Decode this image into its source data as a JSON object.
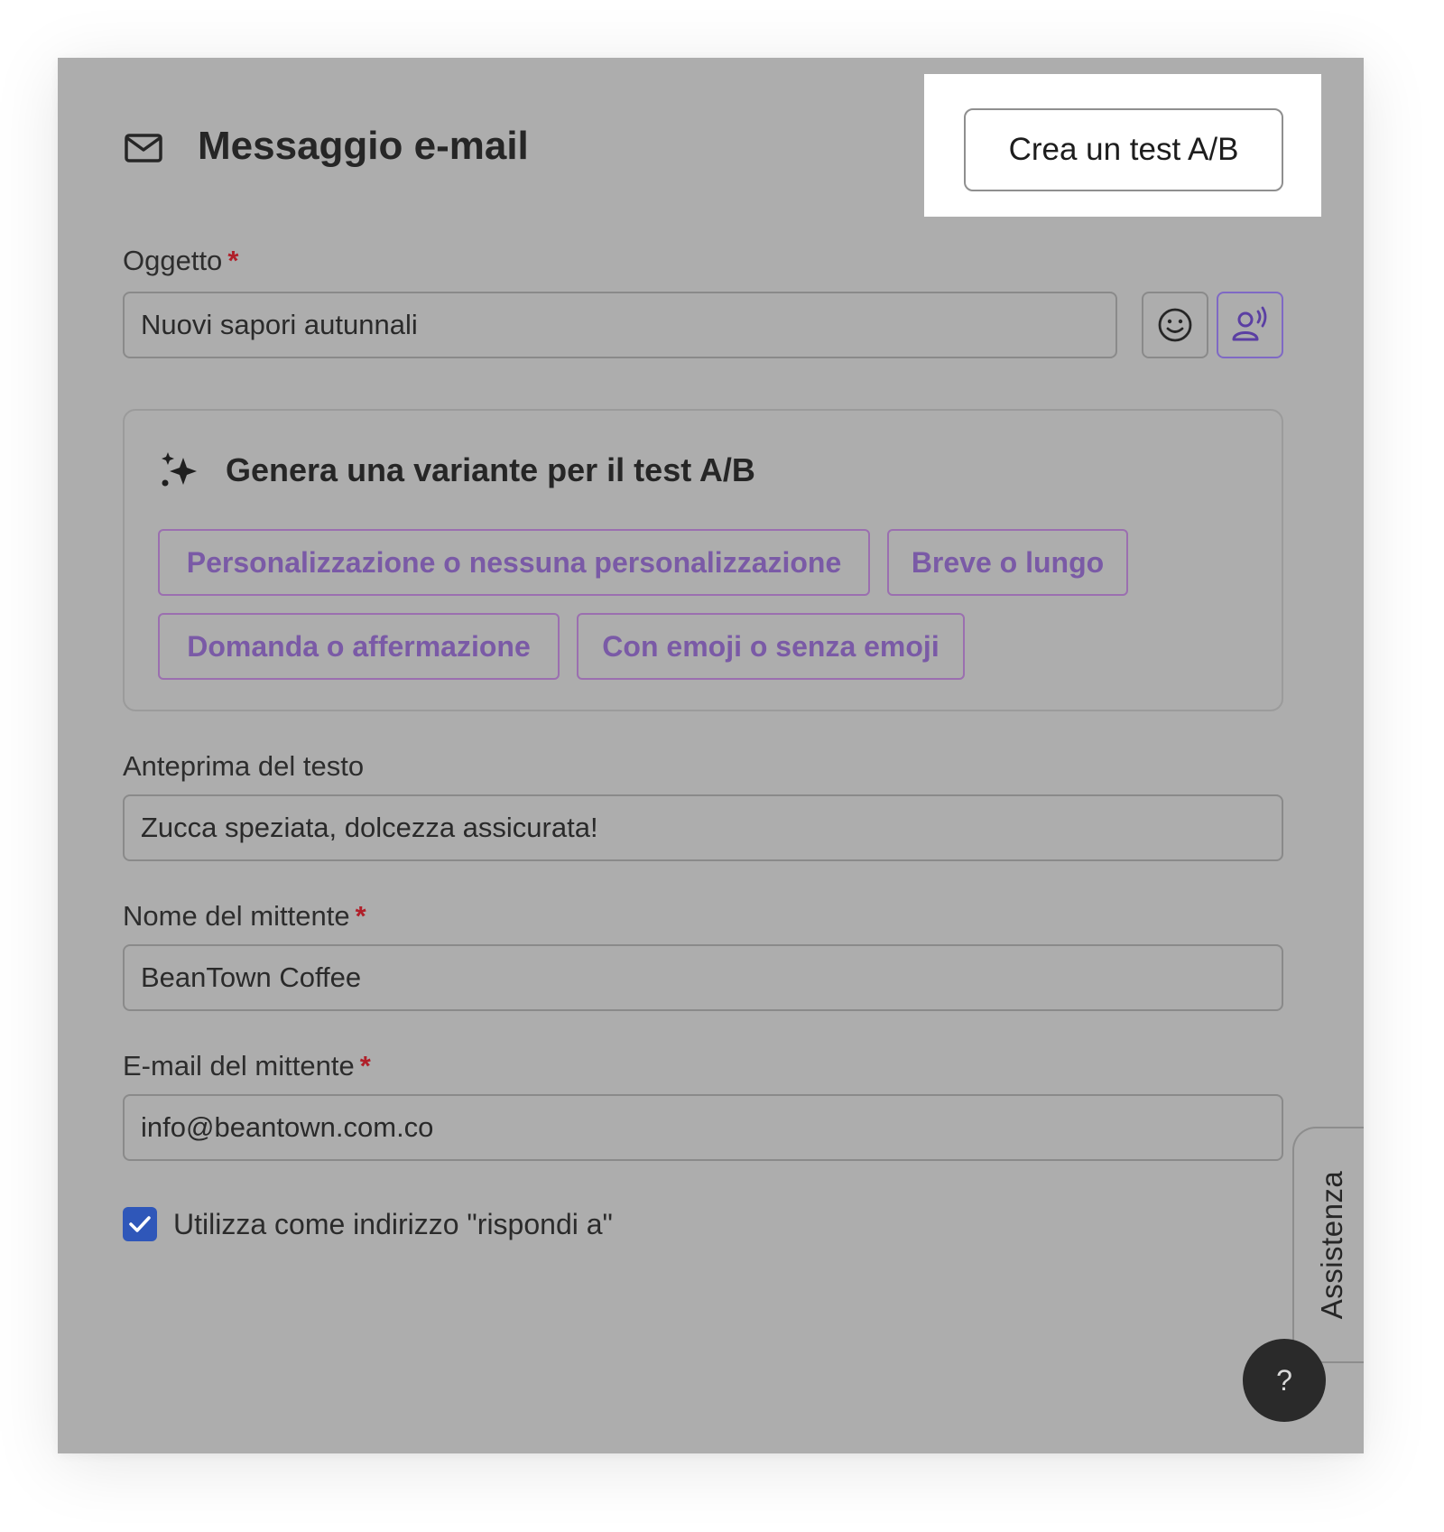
{
  "header": {
    "icon": "mail-icon",
    "title": "Messaggio e-mail",
    "ab_test_button": "Crea un test A/B"
  },
  "subject": {
    "label": "Oggetto",
    "required_mark": "*",
    "value": "Nuovi sapori autunnali",
    "emoji_icon": "smiley-icon",
    "voice_icon": "speaking-person-icon"
  },
  "ai_variants": {
    "icon": "sparkle-icon",
    "title": "Genera una variante per il test A/B",
    "chips": [
      "Personalizzazione o nessuna personalizzazione",
      "Breve o lungo",
      "Domanda o affermazione",
      "Con emoji o senza emoji"
    ]
  },
  "preview_text": {
    "label": "Anteprima del testo",
    "value": "Zucca speziata, dolcezza assicurata!"
  },
  "sender_name": {
    "label": "Nome del mittente",
    "required_mark": "*",
    "value": "BeanTown Coffee"
  },
  "sender_email": {
    "label": "E-mail del mittente",
    "required_mark": "*",
    "value": "info@beantown.com.co"
  },
  "reply_to": {
    "checked": true,
    "label": "Utilizza come indirizzo \"rispondi a\""
  },
  "assist": {
    "tab_label": "Assistenza",
    "help_button": "?"
  },
  "colors": {
    "overlay_gray": "#adadad",
    "required_red": "#b0202a",
    "chip_purple": "#7a5aa6",
    "checkbox_blue": "#2f57b9",
    "help_button_dark": "#2a2a2a"
  }
}
